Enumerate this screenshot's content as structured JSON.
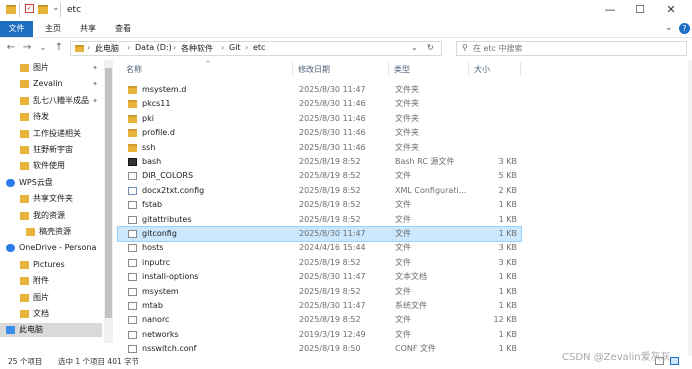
{
  "window": {
    "title": "etc",
    "controls": [
      "—",
      "☐",
      "✕"
    ]
  },
  "ribbon": {
    "tabs": [
      "文件",
      "主页",
      "共享",
      "查看"
    ]
  },
  "address": {
    "breadcrumbs": [
      "此电脑",
      "Data (D:)",
      "各种软件",
      "Git",
      "etc"
    ],
    "search_placeholder": "在 etc 中搜索"
  },
  "nav_pane": {
    "items": [
      {
        "label": "图片",
        "pinned": true,
        "icon": "folder-icon"
      },
      {
        "label": "Zevalin",
        "pinned": true,
        "icon": "folder-icon"
      },
      {
        "label": "乱七八糟半成品",
        "pinned": true,
        "icon": "folder-icon"
      },
      {
        "label": "待发",
        "pinned": false,
        "icon": "folder-icon"
      },
      {
        "label": "工作投递相关",
        "pinned": false,
        "icon": "folder-icon"
      },
      {
        "label": "狂野新宇宙",
        "pinned": false,
        "icon": "folder-icon"
      },
      {
        "label": "软件使用",
        "pinned": false,
        "icon": "folder-icon"
      },
      {
        "label": "WPS云盘",
        "pinned": false,
        "icon": "cloud-icon"
      },
      {
        "label": "共享文件夹",
        "pinned": false,
        "icon": "folder-icon"
      },
      {
        "label": "我的资源",
        "pinned": false,
        "icon": "folder-icon"
      },
      {
        "label": "稿壳资源",
        "pinned": false,
        "icon": "folder-icon"
      },
      {
        "label": "OneDrive - Persona",
        "pinned": false,
        "icon": "cloud-icon"
      },
      {
        "label": "Pictures",
        "pinned": false,
        "icon": "folder-icon"
      },
      {
        "label": "附件",
        "pinned": false,
        "icon": "folder-icon"
      },
      {
        "label": "图片",
        "pinned": false,
        "icon": "folder-icon"
      },
      {
        "label": "文档",
        "pinned": false,
        "icon": "folder-icon"
      },
      {
        "label": "此电脑",
        "pinned": false,
        "icon": "computer-icon"
      }
    ]
  },
  "list": {
    "headers": {
      "name": "名称",
      "date": "修改日期",
      "type": "类型",
      "size": "大小"
    },
    "rows": [
      {
        "name": "msystem.d",
        "date": "2025/8/30 11:47",
        "type": "文件夹",
        "size": "",
        "icon": "folder"
      },
      {
        "name": "pkcs11",
        "date": "2025/8/30 11:46",
        "type": "文件夹",
        "size": "",
        "icon": "folder"
      },
      {
        "name": "pki",
        "date": "2025/8/30 11:46",
        "type": "文件夹",
        "size": "",
        "icon": "folder"
      },
      {
        "name": "profile.d",
        "date": "2025/8/30 11:46",
        "type": "文件夹",
        "size": "",
        "icon": "folder"
      },
      {
        "name": "ssh",
        "date": "2025/8/30 11:46",
        "type": "文件夹",
        "size": "",
        "icon": "folder"
      },
      {
        "name": "bash",
        "date": "2025/8/19 8:52",
        "type": "Bash RC 源文件",
        "size": "3 KB",
        "icon": "bash"
      },
      {
        "name": "DIR_COLORS",
        "date": "2025/8/19 8:52",
        "type": "文件",
        "size": "5 KB",
        "icon": "file"
      },
      {
        "name": "docx2txt.config",
        "date": "2025/8/19 8:52",
        "type": "XML Configurati...",
        "size": "2 KB",
        "icon": "xml"
      },
      {
        "name": "fstab",
        "date": "2025/8/19 8:52",
        "type": "文件",
        "size": "1 KB",
        "icon": "file"
      },
      {
        "name": "gitattributes",
        "date": "2025/8/19 8:52",
        "type": "文件",
        "size": "1 KB",
        "icon": "file"
      },
      {
        "name": "gitconfig",
        "date": "2025/8/30 11:47",
        "type": "文件",
        "size": "1 KB",
        "icon": "file",
        "selected": true
      },
      {
        "name": "hosts",
        "date": "2024/4/16 15:44",
        "type": "文件",
        "size": "3 KB",
        "icon": "file"
      },
      {
        "name": "inputrc",
        "date": "2025/8/19 8:52",
        "type": "文件",
        "size": "3 KB",
        "icon": "file"
      },
      {
        "name": "install-options",
        "date": "2025/8/30 11:47",
        "type": "文本文档",
        "size": "1 KB",
        "icon": "file"
      },
      {
        "name": "msystem",
        "date": "2025/8/19 8:52",
        "type": "文件",
        "size": "1 KB",
        "icon": "file"
      },
      {
        "name": "mtab",
        "date": "2025/8/30 11:47",
        "type": "系统文件",
        "size": "1 KB",
        "icon": "file"
      },
      {
        "name": "nanorc",
        "date": "2025/8/19 8:52",
        "type": "文件",
        "size": "12 KB",
        "icon": "file"
      },
      {
        "name": "networks",
        "date": "2019/3/19 12:49",
        "type": "文件",
        "size": "1 KB",
        "icon": "file"
      },
      {
        "name": "nsswitch.conf",
        "date": "2025/8/19 8:50",
        "type": "CONF 文件",
        "size": "1 KB",
        "icon": "file"
      }
    ]
  },
  "status": {
    "count": "25 个项目",
    "selection": "选中 1 个项目 401 字节"
  },
  "watermark": "CSDN @Zevalin爱灰灰",
  "colors": {
    "accent": "#1d6ec2",
    "selected_row": "#cce8ff",
    "folder": "#e8b33a"
  }
}
